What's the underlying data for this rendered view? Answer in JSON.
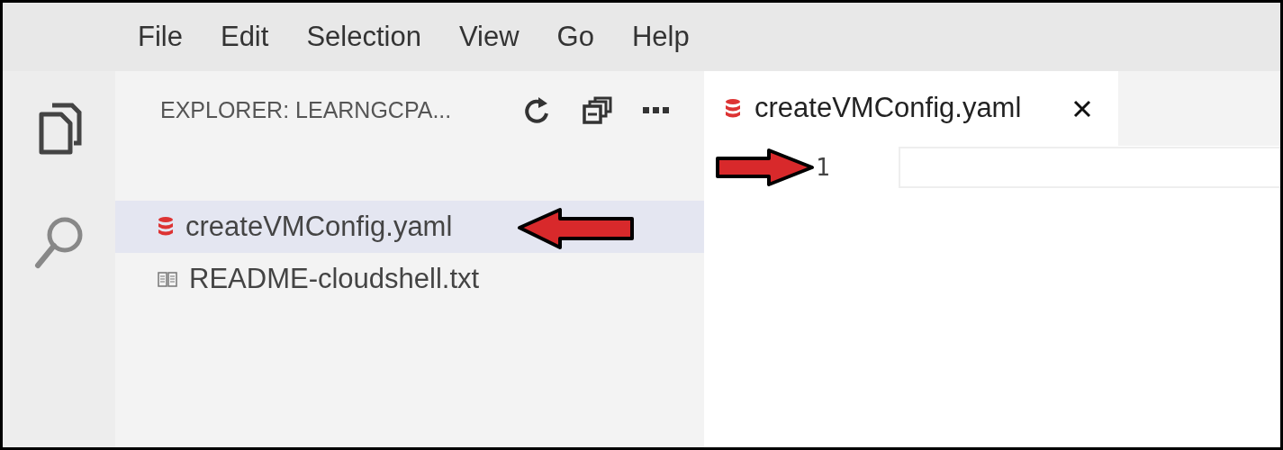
{
  "menu": [
    {
      "label": "File"
    },
    {
      "label": "Edit"
    },
    {
      "label": "Selection"
    },
    {
      "label": "View"
    },
    {
      "label": "Go"
    },
    {
      "label": "Help"
    }
  ],
  "activity_bar": [
    {
      "kind": "explorer",
      "selected": true
    },
    {
      "kind": "search",
      "selected": false
    }
  ],
  "explorer": {
    "title": "EXPLORER: LEARNGCPA...",
    "files": [
      {
        "name": "createVMConfig.yaml",
        "kind": "yaml",
        "selected": true
      },
      {
        "name": "README-cloudshell.txt",
        "kind": "text",
        "selected": false
      }
    ]
  },
  "tabs": [
    {
      "label": "createVMConfig.yaml",
      "kind": "yaml",
      "selected": true
    }
  ],
  "editor": {
    "line_numbers": [
      "1"
    ]
  }
}
